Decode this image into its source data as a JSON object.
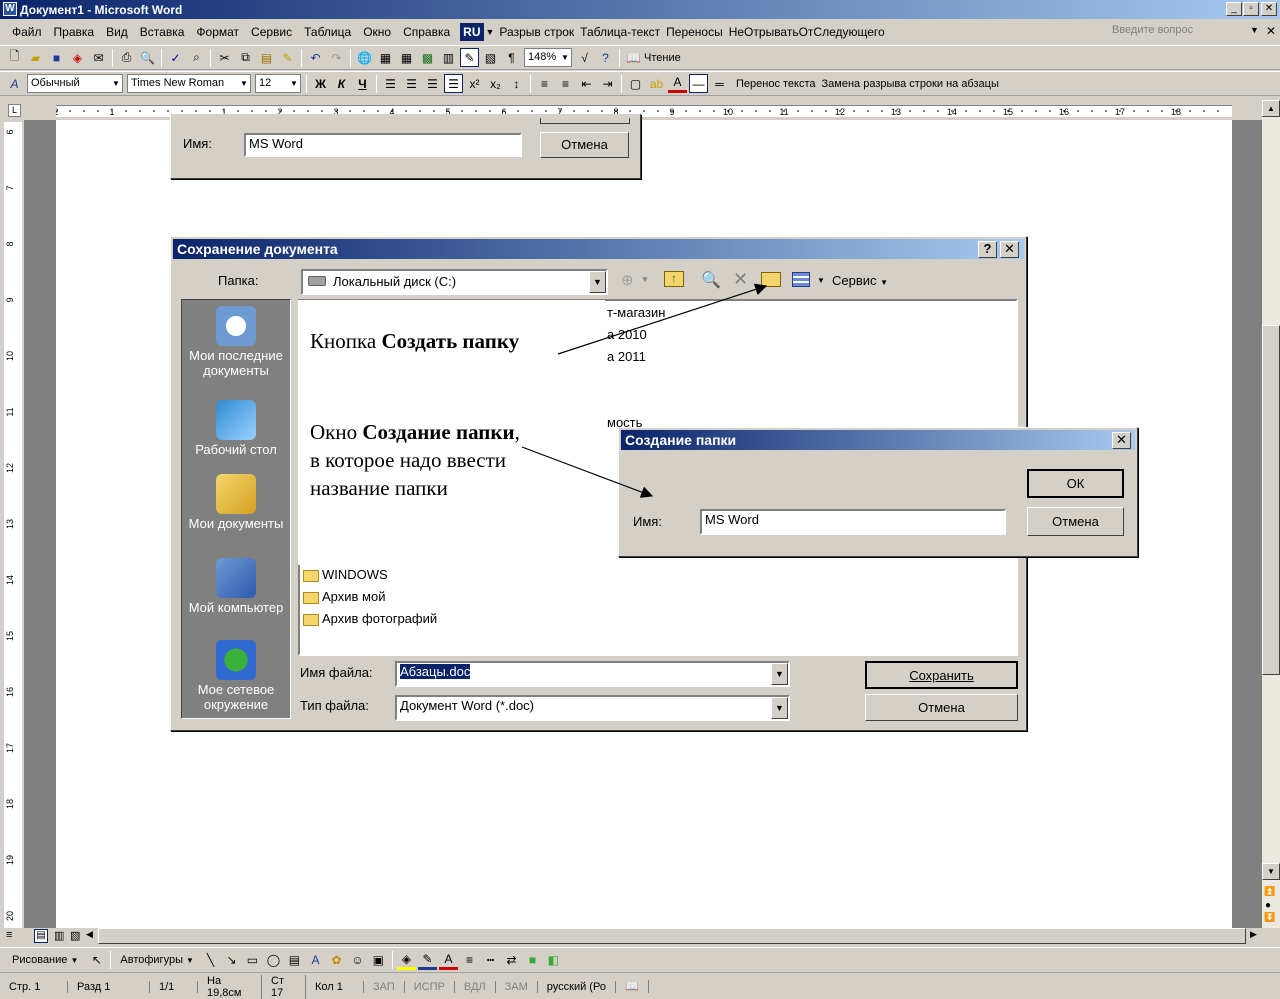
{
  "window": {
    "title": "Документ1 - Microsoft Word",
    "min": "_",
    "max": "▫",
    "close": "✕"
  },
  "menu": {
    "items": [
      "Файл",
      "Правка",
      "Вид",
      "Вставка",
      "Формат",
      "Сервис",
      "Таблица",
      "Окно",
      "Справка"
    ],
    "lang": "RU",
    "macros": [
      "Разрыв строк",
      "Таблица-текст",
      "Переносы",
      "НеОтрыватьОтСледующего"
    ],
    "help_placeholder": "Введите вопрос"
  },
  "toolbar": {
    "zoom": "148%",
    "reading": "Чтение",
    "style": "Обычный",
    "font": "Times New Roman",
    "size": "12",
    "bold": "Ж",
    "italic": "К",
    "underline": "Ч",
    "wrap_text": "Перенос текста",
    "replace_breaks": "Замена разрыва строки на абзацы"
  },
  "ruler": {
    "label": "L",
    "ticks": [
      "2",
      "1",
      "1",
      "2",
      "3",
      "4",
      "5",
      "6",
      "7",
      "8",
      "9",
      "10",
      "11",
      "12",
      "13",
      "14",
      "15",
      "16",
      "17",
      "18"
    ],
    "vticks": [
      "6",
      "7",
      "8",
      "9",
      "10",
      "11",
      "12",
      "13",
      "14",
      "15",
      "16",
      "17",
      "18",
      "19",
      "20"
    ]
  },
  "bg_dialog": {
    "name_label": "Имя:",
    "name_value": "MS Word",
    "cancel": "Отмена"
  },
  "save_dialog": {
    "title": "Сохранение документа",
    "help": "?",
    "close": "✕",
    "folder_label": "Папка:",
    "folder_value": "Локальный диск (C:)",
    "service": "Сервис",
    "places": [
      "Мои последние документы",
      "Рабочий стол",
      "Мои документы",
      "Мой компьютер",
      "Мое сетевое окружение"
    ],
    "files_top": [
      "т-магазин",
      "а 2010",
      "а 2011",
      "мость"
    ],
    "files": [
      "WINDOWS",
      "Архив мой",
      "Архив фотографий"
    ],
    "filename_label": "Имя файла:",
    "filename_value": "Абзацы.doc",
    "filetype_label": "Тип файла:",
    "filetype_value": "Документ Word (*.doc)",
    "save": "Сохранить",
    "cancel": "Отмена"
  },
  "annotation1": {
    "text_before": "Кнопка ",
    "bold": "Создать папку"
  },
  "annotation2": {
    "text_before": "Окно ",
    "bold": "Создание папки",
    "text_after": ",",
    "line2": "в которое надо ввести",
    "line3": "название папки"
  },
  "new_folder": {
    "title": "Создание папки",
    "close": "✕",
    "ok": "ОК",
    "name_label": "Имя:",
    "name_value": "MS Word",
    "cancel": "Отмена"
  },
  "drawing": {
    "draw": "Рисование",
    "autoshapes": "Автофигуры"
  },
  "status": {
    "items": [
      "Стр. 1",
      "Разд 1",
      "1/1",
      "На 19,8см",
      "Ст 17",
      "Кол 1",
      "ЗАП",
      "ИСПР",
      "ВДЛ",
      "ЗАМ",
      "русский (Ро"
    ]
  }
}
